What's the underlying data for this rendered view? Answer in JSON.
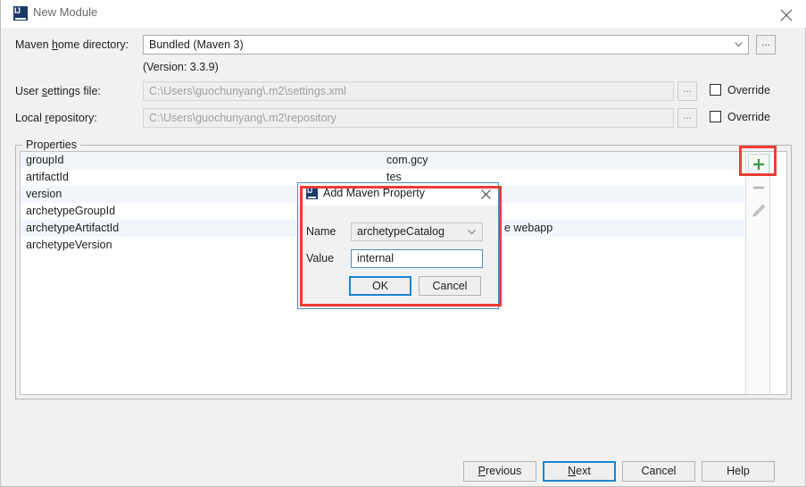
{
  "window": {
    "title": "New Module",
    "icon": "intellij-idea-icon",
    "close_label": "✕"
  },
  "form": {
    "maven_home": {
      "label_pre": "Maven ",
      "label_mnemonic": "h",
      "label_post": "ome directory:",
      "label_full": "Maven home directory:",
      "value": "Bundled (Maven 3)",
      "ellipsis_label": "...",
      "version_note": "(Version: 3.3.9)"
    },
    "user_settings": {
      "label_pre": "User ",
      "label_mnemonic": "s",
      "label_post": "ettings file:",
      "label_full": "User settings file:",
      "value": "C:\\Users\\guochunyang\\.m2\\settings.xml",
      "ellipsis_label": "...",
      "override_label": "Override",
      "override_checked": false
    },
    "local_repository": {
      "label_pre": "Local ",
      "label_mnemonic": "r",
      "label_post": "epository:",
      "label_full": "Local repository:",
      "value": "C:\\Users\\guochunyang\\.m2\\repository",
      "ellipsis_label": "...",
      "override_label": "Override",
      "override_checked": false
    }
  },
  "properties_panel": {
    "legend": "Properties",
    "rows": [
      {
        "key": "groupId",
        "value": "com.gcy"
      },
      {
        "key": "artifactId",
        "value": "tes"
      },
      {
        "key": "version",
        "value": ""
      },
      {
        "key": "archetypeGroupId",
        "value": ""
      },
      {
        "key": "archetypeArtifactId",
        "value": "e webapp"
      },
      {
        "key": "archetypeVersion",
        "value": ""
      }
    ],
    "toolbar": {
      "add_label": "+",
      "add_name": "add-property-button",
      "remove_label": "−",
      "remove_name": "remove-property-button",
      "edit_name": "edit-property-button"
    }
  },
  "dialog": {
    "title": "Add Maven Property",
    "icon": "intellij-idea-icon",
    "close_label": "✕",
    "name_label": "Name",
    "name_value": "archetypeCatalog",
    "value_label": "Value",
    "value_value": "internal",
    "ok_label": "OK",
    "cancel_label": "Cancel"
  },
  "footer": {
    "previous": {
      "pre": "",
      "mnemonic": "P",
      "post": "revious",
      "full": "Previous"
    },
    "next": {
      "pre": "",
      "mnemonic": "N",
      "post": "ext",
      "full": "Next"
    },
    "cancel": {
      "full": "Cancel"
    },
    "help": {
      "full": "Help"
    }
  },
  "colors": {
    "accent_blue": "#1a86d0",
    "highlight_red": "#f03c34",
    "add_green": "#2e9b3d",
    "row_stripe": "#f2f6fb",
    "window_bg": "#f1f1f1"
  }
}
